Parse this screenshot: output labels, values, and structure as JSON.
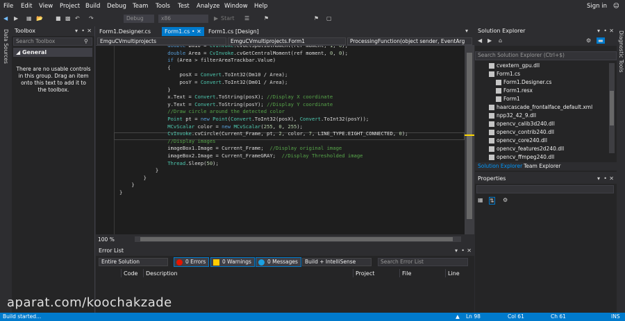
{
  "menubar": {
    "items": [
      "File",
      "Edit",
      "View",
      "Project",
      "Build",
      "Debug",
      "Team",
      "Tools",
      "Test",
      "Analyze",
      "Window",
      "Help"
    ],
    "sign_in": "Sign in"
  },
  "toolbar": {
    "config": "Debug",
    "platform": "x86",
    "start_label": "Start"
  },
  "left_rail": {
    "label": "Data Sources"
  },
  "toolbox": {
    "title": "Toolbox",
    "search_placeholder": "Search Toolbox",
    "group": "General",
    "empty_message": "There are no usable controls in this group. Drag an item onto this text to add it to the toolbox."
  },
  "tabs": [
    {
      "label": "Form1.Designer.cs",
      "active": false
    },
    {
      "label": "Form1.cs",
      "active": true
    },
    {
      "label": "Form1.cs [Design]",
      "active": false
    }
  ],
  "navbar": {
    "project": "EmguCVmultiprojects",
    "class": "EmguCVmultiprojects.Form1",
    "member": "ProcessingFunction(object sender, EventArg"
  },
  "code_lines": [
    "                double Dm10 = CvInvoke.cvGetSpatialMoment(ref moment, 1, 0);",
    "                double Area = CvInvoke.cvGetCentralMoment(ref moment, 0, 0);",
    "                if (Area > filterAreaTrackbar.Value)",
    "                {",
    "                    posX = Convert.ToInt32(Dm10 / Area);",
    "                    posY = Convert.ToInt32(Dm01 / Area);",
    "                }",
    "                x.Text = Convert.ToString(posX); //Display X coordinate",
    "                y.Text = Convert.ToString(posY); //Display Y coordinate",
    "                //Draw circle around the detected color",
    "                Point pt = new Point(Convert.ToInt32(posX), Convert.ToInt32(posY));",
    "                MCvScalar color = new MCvScalar(255, 0, 255);",
    "                CvInvoke.cvCircle(Current_Frame, pt, 2, color, 7, LINE_TYPE.EIGHT_CONNECTED, 0);",
    "                //Display images",
    "                imageBox1.Image = Current_Frame;  //Display original image",
    "                imageBox2.Image = Current_FrameGRAY;  //Display Thresholded image",
    "                Thread.Sleep(50);",
    "            }",
    "        }",
    "    }",
    "}"
  ],
  "zoom": "100 %",
  "error_list": {
    "title": "Error List",
    "scope": "Entire Solution",
    "errors": "0 Errors",
    "warnings": "0 Warnings",
    "messages": "0 Messages",
    "build_filter": "Build + IntelliSense",
    "search_placeholder": "Search Error List",
    "columns": [
      "Code",
      "Description",
      "Project",
      "File",
      "Line"
    ]
  },
  "solution_explorer": {
    "title": "Solution Explorer",
    "search_placeholder": "Search Solution Explorer (Ctrl+$)",
    "items": [
      {
        "label": "cvextern_gpu.dll",
        "indent": 2
      },
      {
        "label": "Form1.cs",
        "indent": 2
      },
      {
        "label": "Form1.Designer.cs",
        "indent": 3
      },
      {
        "label": "Form1.resx",
        "indent": 3
      },
      {
        "label": "Form1",
        "indent": 3
      },
      {
        "label": "haarcascade_frontalface_default.xml",
        "indent": 2
      },
      {
        "label": "npp32_42_9.dll",
        "indent": 2
      },
      {
        "label": "opencv_calib3d240.dll",
        "indent": 2
      },
      {
        "label": "opencv_contrib240.dll",
        "indent": 2
      },
      {
        "label": "opencv_core240.dll",
        "indent": 2
      },
      {
        "label": "opencv_features2d240.dll",
        "indent": 2
      },
      {
        "label": "opencv_ffmpeg240.dll",
        "indent": 2
      }
    ],
    "bottom_tabs": [
      "Solution Explorer",
      "Team Explorer"
    ]
  },
  "properties": {
    "title": "Properties"
  },
  "right_rail": {
    "label": "Diagnostic Tools"
  },
  "statusbar": {
    "status": "Build started...",
    "line": "Ln 98",
    "col": "Col 61",
    "ch": "Ch 61",
    "mode": "INS"
  },
  "watermark": "aparat.com/koochakzade",
  "colors": {
    "accent": "#007acc",
    "background": "#2d2d30",
    "editor": "#1e1e1e"
  }
}
